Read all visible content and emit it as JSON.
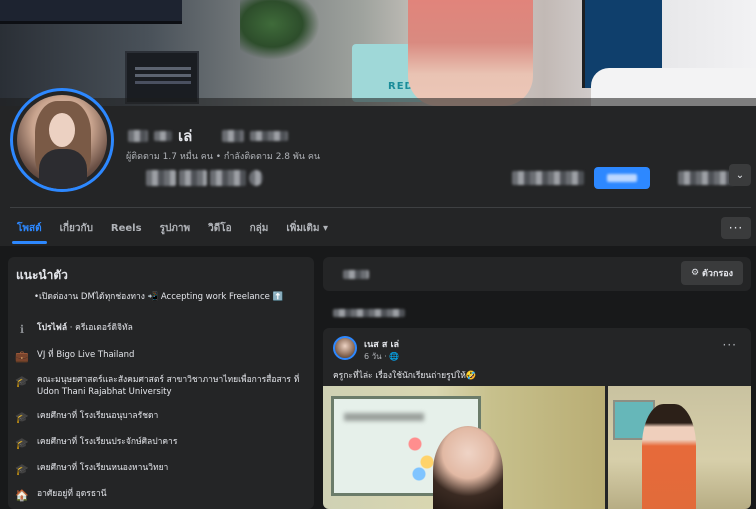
{
  "profile": {
    "name_visible": "เล่",
    "stats": "ผู้ติดตาม 1.7 หมื่น คน • กำลังติดตาม 2.8 พัน คน",
    "brand_blue": "#2d88ff"
  },
  "cover": {
    "bag_text": "REDU"
  },
  "tabs": [
    {
      "label": "โพสต์",
      "active": true
    },
    {
      "label": "เกี่ยวกับ",
      "active": false
    },
    {
      "label": "Reels",
      "active": false
    },
    {
      "label": "รูปภาพ",
      "active": false
    },
    {
      "label": "วิดีโอ",
      "active": false
    },
    {
      "label": "กลุ่ม",
      "active": false
    },
    {
      "label": "เพิ่มเติม",
      "active": false
    }
  ],
  "tab_more_caret": "▾",
  "more_dots": "···",
  "action_caret": "⌄",
  "intro": {
    "title": "แนะนำตัว",
    "bio": "•เปิดต่องาน DMได้ทุกช่องทาง 📲 Accepting work Freelance ⬆️",
    "items": [
      {
        "icon": "info-icon",
        "glyph": "ℹ",
        "bold": "โปรไฟล์",
        "text": " · ครีเอเตอร์ดิจิทัล"
      },
      {
        "icon": "briefcase-icon",
        "glyph": "💼",
        "bold": "",
        "text": "VJ ที่ Bigo Live Thailand"
      },
      {
        "icon": "graduation-cap-icon",
        "glyph": "🎓",
        "bold": "",
        "text": "คณะมนุษยศาสตร์และสังคมศาสตร์ สาขาวิชาภาษาไทยเพื่อการสื่อสาร ที่ Udon Thani Rajabhat University"
      },
      {
        "icon": "graduation-cap-icon",
        "glyph": "🎓",
        "bold": "",
        "text": "เคยศึกษาที่ โรงเรียนอนุบาลรัชดา"
      },
      {
        "icon": "graduation-cap-icon",
        "glyph": "🎓",
        "bold": "",
        "text": "เคยศึกษาที่ โรงเรียนประจักษ์ศิลปาคาร"
      },
      {
        "icon": "graduation-cap-icon",
        "glyph": "🎓",
        "bold": "",
        "text": "เคยศึกษาที่ โรงเรียนหนองหานวิทยา"
      },
      {
        "icon": "home-icon",
        "glyph": "🏠",
        "bold": "",
        "text": "อาศัยอยู่ที่ อุดรธานี"
      }
    ]
  },
  "filter": {
    "label": "ตัวกรอง",
    "icon": "sliders-icon",
    "glyph": "⚙"
  },
  "post": {
    "author": "เนส ส เล่",
    "meta": "6 วัน · 🌐",
    "text": "ครูกะที่ไล่ะ เรื่องใช้นักเรียนถ่ายรูปให้🤣",
    "dots": "···"
  }
}
